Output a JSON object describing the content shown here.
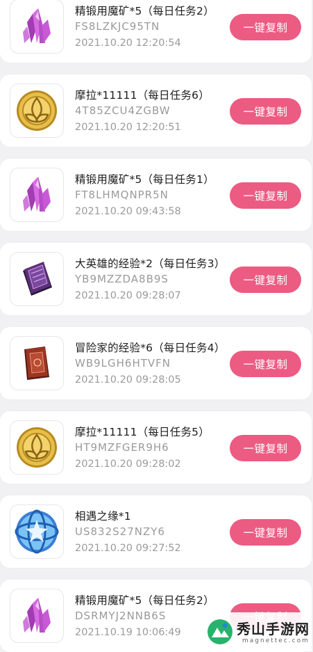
{
  "copy_label": "一键复制",
  "items": [
    {
      "title": "精锻用魔矿*5（每日任务2）",
      "code": "FS8LZKJC95TN",
      "time": "2021.10.20 12:20:54",
      "icon": "crystal-icon"
    },
    {
      "title": "摩拉*11111（每日任务6）",
      "code": "4T85ZCU4ZGBW",
      "time": "2021.10.20 12:20:51",
      "icon": "mora-coin-icon"
    },
    {
      "title": "精锻用魔矿*5（每日任务1）",
      "code": "FT8LHMQNPR5N",
      "time": "2021.10.20 09:43:58",
      "icon": "crystal-icon"
    },
    {
      "title": "大英雄的经验*2（每日任务3）",
      "code": "YB9MZZDA8B9S",
      "time": "2021.10.20 09:28:07",
      "icon": "purple-book-icon"
    },
    {
      "title": "冒险家的经验*6（每日任务4）",
      "code": "WB9LGH6HTVFN",
      "time": "2021.10.20 09:28:05",
      "icon": "red-book-icon"
    },
    {
      "title": "摩拉*11111（每日任务5）",
      "code": "HT9MZFGER9H6",
      "time": "2021.10.20 09:28:02",
      "icon": "mora-coin-icon"
    },
    {
      "title": "相遇之缘*1",
      "code": "US832S27NZY6",
      "time": "2021.10.20 09:27:52",
      "icon": "fate-orb-icon"
    },
    {
      "title": "精锻用魔矿*5（每日任务2）",
      "code": "DSRMYJ2NNB6S",
      "time": "2021.10.19 10:06:49",
      "icon": "crystal-icon"
    }
  ],
  "watermark": {
    "name": "秀山手游网",
    "url": "magnettec.com"
  },
  "colors": {
    "accent": "#ec5b82",
    "background": "#f1f0f2",
    "card": "#ffffff"
  }
}
